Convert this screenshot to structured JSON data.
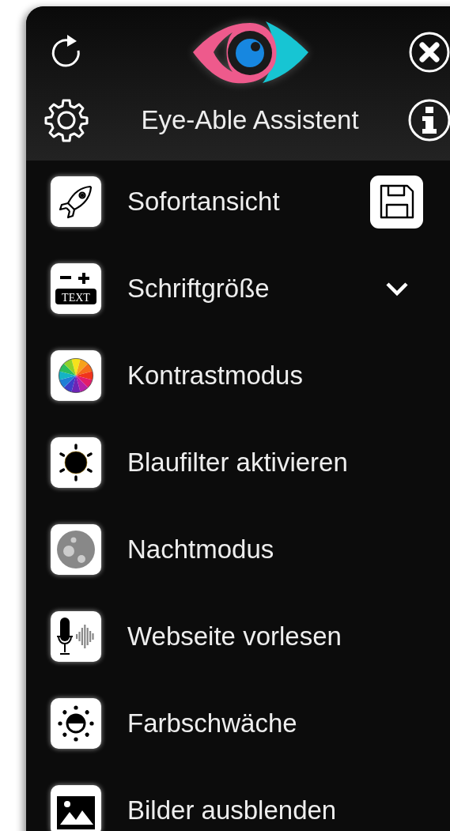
{
  "header": {
    "title": "Eye-Able Assistent"
  },
  "items": [
    {
      "label": "Sofortansicht",
      "kind": "rocket",
      "trailing": {
        "kind": "save"
      }
    },
    {
      "label": "Schriftgröße",
      "kind": "text-size",
      "icon_text": "TEXT",
      "trailing": {
        "kind": "chevron",
        "expanded": false
      }
    },
    {
      "label": "Kontrastmodus",
      "kind": "color-wheel"
    },
    {
      "label": "Blaufilter aktivieren",
      "kind": "sun"
    },
    {
      "label": "Nachtmodus",
      "kind": "moon"
    },
    {
      "label": "Webseite vorlesen",
      "kind": "microphone"
    },
    {
      "label": "Farbschwäche",
      "kind": "half-sun"
    },
    {
      "label": "Bilder ausblenden",
      "kind": "image"
    }
  ]
}
